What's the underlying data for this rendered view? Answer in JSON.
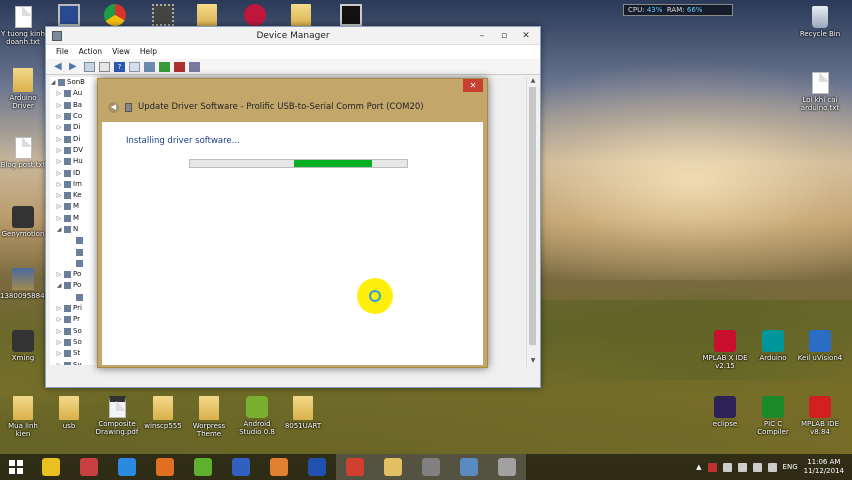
{
  "sysmon": {
    "cpu_label": "CPU:",
    "cpu_value": "43%",
    "ram_label": "RAM:",
    "ram_value": "66%"
  },
  "desktop_left": [
    {
      "label": "Y tuong kinh doanh.txt",
      "type": "file"
    },
    {
      "label": "Arduino Driver",
      "type": "folder"
    },
    {
      "label": "Blog post.txt",
      "type": "file"
    },
    {
      "label": "Genymotion",
      "type": "app"
    },
    {
      "label": "1380095884...",
      "type": "image"
    },
    {
      "label": "Xming",
      "type": "app"
    }
  ],
  "desktop_top": [
    {
      "label": "",
      "type": "file"
    },
    {
      "label": "",
      "type": "monitor"
    },
    {
      "label": "",
      "type": "chrome"
    },
    {
      "label": "",
      "type": "chip"
    },
    {
      "label": "",
      "type": "folder"
    },
    {
      "label": "",
      "type": "lg"
    },
    {
      "label": "",
      "type": "folder"
    },
    {
      "label": "",
      "type": "screen"
    }
  ],
  "desktop_right": [
    {
      "label": "Recycle Bin",
      "type": "bin"
    },
    {
      "label": "Loi khi cai arduino.txt",
      "type": "file"
    }
  ],
  "desktop_right_apps": [
    {
      "label": "MPLAB X IDE v2.15",
      "color": "#c8102e"
    },
    {
      "label": "Arduino",
      "color": "#00979c"
    },
    {
      "label": "Keil uVision4",
      "color": "#2b6cc4"
    },
    {
      "label": "eclipse",
      "color": "#2c2255"
    },
    {
      "label": "PIC C Compiler",
      "color": "#1a8a2a"
    },
    {
      "label": "MPLAB IDE v8.84",
      "color": "#d02020"
    }
  ],
  "desktop_bottom": [
    {
      "label": "Mua linh kien",
      "type": "folder"
    },
    {
      "label": "usb",
      "type": "folder"
    },
    {
      "label": "Composite Drawing.pdf",
      "type": "pdf"
    },
    {
      "label": "winscp555",
      "type": "folder"
    },
    {
      "label": "Worpress Theme",
      "type": "folder"
    },
    {
      "label": "Android Studio 0.8",
      "type": "android"
    },
    {
      "label": "8051UART",
      "type": "folder"
    }
  ],
  "device_manager": {
    "title": "Device Manager",
    "menu": [
      "File",
      "Action",
      "View",
      "Help"
    ],
    "tree": [
      {
        "label": "SonB",
        "arrow": "◢"
      },
      {
        "label": "Au",
        "arrow": "▷"
      },
      {
        "label": "Ba",
        "arrow": "▷"
      },
      {
        "label": "Co",
        "arrow": "▷"
      },
      {
        "label": "Di",
        "arrow": "▷"
      },
      {
        "label": "Di",
        "arrow": "▷"
      },
      {
        "label": "DV",
        "arrow": "▷"
      },
      {
        "label": "Hu",
        "arrow": "▷"
      },
      {
        "label": "ID",
        "arrow": "▷"
      },
      {
        "label": "Im",
        "arrow": "▷"
      },
      {
        "label": "Ke",
        "arrow": "▷"
      },
      {
        "label": "M",
        "arrow": "▷"
      },
      {
        "label": "M",
        "arrow": "▷"
      },
      {
        "label": "N",
        "arrow": "◢"
      },
      {
        "label": "",
        "arrow": ""
      },
      {
        "label": "",
        "arrow": ""
      },
      {
        "label": "",
        "arrow": ""
      },
      {
        "label": "Po",
        "arrow": "▷"
      },
      {
        "label": "Po",
        "arrow": "◢"
      },
      {
        "label": "",
        "arrow": ""
      },
      {
        "label": "Pri",
        "arrow": "▷"
      },
      {
        "label": "Pr",
        "arrow": "▷"
      },
      {
        "label": "So",
        "arrow": "▷"
      },
      {
        "label": "So",
        "arrow": "▷"
      },
      {
        "label": "St",
        "arrow": "▷"
      },
      {
        "label": "Sy",
        "arrow": "▷"
      }
    ]
  },
  "dialog": {
    "title": "Update Driver Software - Prolific USB-to-Serial Comm Port (COM20)",
    "message": "Installing driver software...",
    "progress_start": 0.48,
    "progress_width": 0.36,
    "close": "✕"
  },
  "taskbar": {
    "apps": [
      {
        "name": "apps-grid",
        "color": "#e8c020"
      },
      {
        "name": "paint",
        "color": "#c84040"
      },
      {
        "name": "ie",
        "color": "#2a8ae0"
      },
      {
        "name": "firefox",
        "color": "#e07020"
      },
      {
        "name": "app-green",
        "color": "#60b030"
      },
      {
        "name": "app-c",
        "color": "#3060c0"
      },
      {
        "name": "media",
        "color": "#e08030"
      },
      {
        "name": "isis",
        "color": "#2050b0"
      },
      {
        "name": "chrome",
        "color": "#d04030"
      },
      {
        "name": "explorer",
        "color": "#e0c060"
      },
      {
        "name": "calculator",
        "color": "#808080"
      },
      {
        "name": "device-manager",
        "color": "#5a8abf"
      },
      {
        "name": "installer",
        "color": "#a0a0a0"
      }
    ],
    "language": "ENG",
    "time": "11:06 AM",
    "date": "11/12/2014"
  }
}
